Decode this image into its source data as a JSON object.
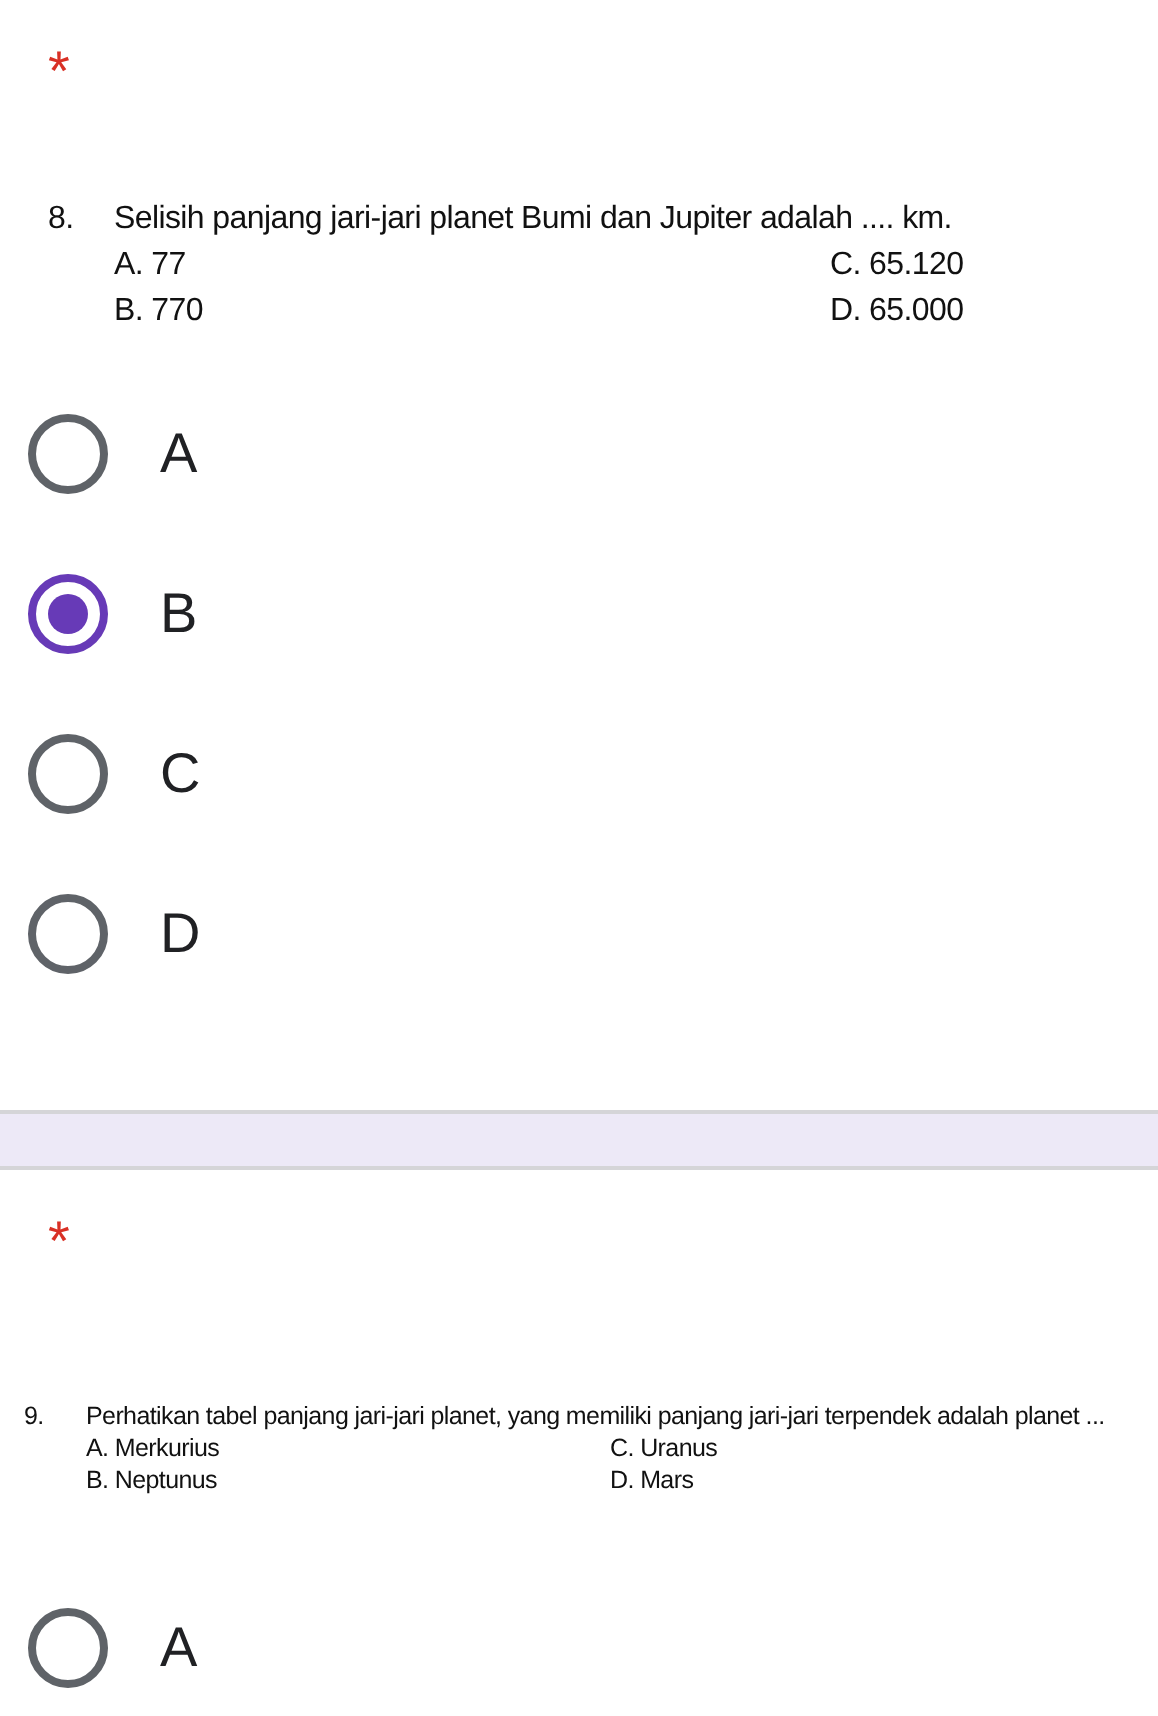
{
  "questions": [
    {
      "required_mark": "*",
      "kind": "large",
      "number": "8.",
      "text": "Selisih panjang jari-jari planet Bumi dan Jupiter adalah .... km.",
      "answer_choices": [
        "A.  77",
        "C. 65.120",
        "B.  770",
        "D. 65.000"
      ],
      "options": [
        {
          "label": "A",
          "selected": false
        },
        {
          "label": "B",
          "selected": true
        },
        {
          "label": "C",
          "selected": false
        },
        {
          "label": "D",
          "selected": false
        }
      ]
    },
    {
      "required_mark": "*",
      "kind": "small",
      "number": "9.",
      "text": "Perhatikan tabel panjang jari-jari planet, yang memiliki panjang jari-jari terpendek adalah planet ...",
      "answer_choices": [
        "A. Merkurius",
        "C. Uranus",
        "B. Neptunus",
        "D. Mars"
      ],
      "options": [
        {
          "label": "A",
          "selected": false
        }
      ]
    }
  ]
}
